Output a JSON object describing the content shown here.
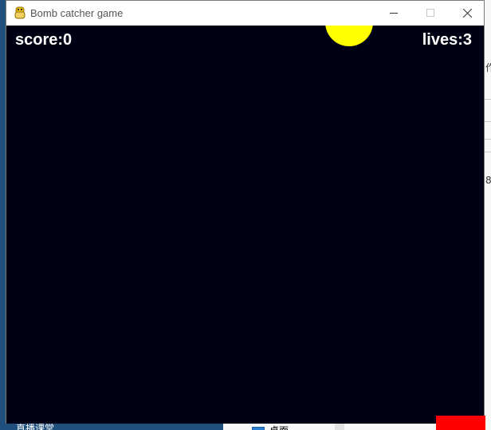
{
  "window": {
    "title": "Bomb catcher game",
    "app_icon": "python-icon",
    "controls": {
      "minimize_icon": "minimize-icon",
      "maximize_icon": "maximize-icon",
      "close_icon": "close-icon"
    }
  },
  "game": {
    "score_text": "score:0",
    "lives_text": "lives:3",
    "background_color": "#000014",
    "bomb_color": "#ffff00",
    "paddle_color": "#ff0000",
    "text_color": "#ffffff"
  },
  "desktop": {
    "taskbar_label": "直播课堂",
    "folder_label": "桌面",
    "edge_chars": [
      "作",
      "8"
    ]
  }
}
